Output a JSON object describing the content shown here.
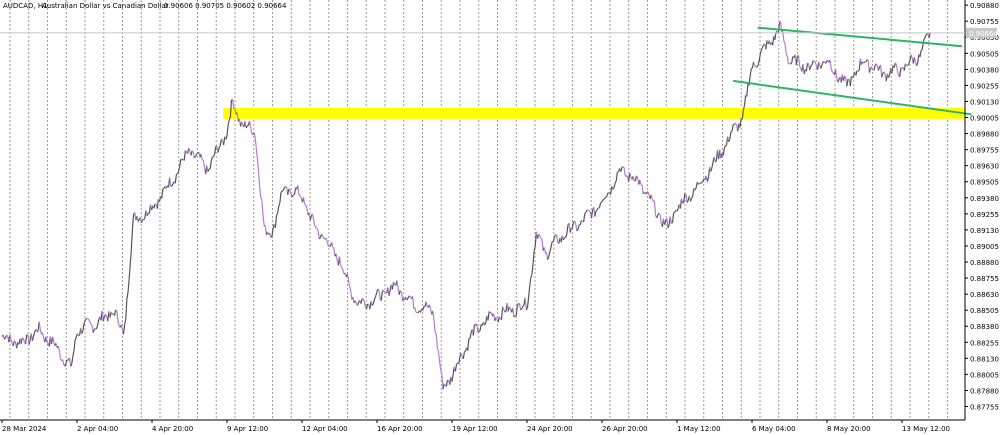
{
  "header": {
    "symbol_tf": "AUDCAD, H1:",
    "description": "Australian Dollar vs Canadian Dollar",
    "ohlc": "0.90606 0.90705 0.90602 0.90664"
  },
  "price_tag": "0.90664",
  "chart_data": {
    "type": "line",
    "symbol": "AUDCAD",
    "timeframe": "H1",
    "ylim": [
      0.8765,
      0.9092
    ],
    "y_ticks": [
      "0.90880",
      "0.90755",
      "0.90630",
      "0.90505",
      "0.90380",
      "0.90255",
      "0.90130",
      "0.90005",
      "0.89880",
      "0.89755",
      "0.89630",
      "0.89505",
      "0.89380",
      "0.89255",
      "0.89130",
      "0.89005",
      "0.88880",
      "0.88755",
      "0.88630",
      "0.88505",
      "0.88380",
      "0.88255",
      "0.88130",
      "0.88005",
      "0.87880",
      "0.87755"
    ],
    "x_ticks": [
      "28 Mar 2024",
      "2 Apr 04:00",
      "4 Apr 20:00",
      "9 Apr 12:00",
      "12 Apr 04:00",
      "16 Apr 20:00",
      "19 Apr 12:00",
      "24 Apr 20:00",
      "26 Apr 20:00",
      "1 May 12:00",
      "6 May 04:00",
      "8 May 20:00",
      "13 May 12:00"
    ],
    "x_tick_index": [
      0,
      4,
      8,
      12,
      16,
      20,
      24,
      28,
      32,
      36,
      40,
      44,
      48
    ],
    "n_periods": 52,
    "grid_vertical": true,
    "price_path": [
      [
        0,
        0.883
      ],
      [
        1,
        0.8825
      ],
      [
        2,
        0.8835
      ],
      [
        3,
        0.882
      ],
      [
        3.7,
        0.8805
      ],
      [
        4,
        0.8835
      ],
      [
        5,
        0.884
      ],
      [
        6,
        0.885
      ],
      [
        6.5,
        0.883
      ],
      [
        7,
        0.892
      ],
      [
        8,
        0.893
      ],
      [
        9,
        0.895
      ],
      [
        10,
        0.8975
      ],
      [
        11,
        0.896
      ],
      [
        12,
        0.899
      ],
      [
        12.3,
        0.9012
      ],
      [
        12.8,
        0.8995
      ],
      [
        13.5,
        0.899
      ],
      [
        14,
        0.891
      ],
      [
        14.5,
        0.8915
      ],
      [
        15,
        0.8945
      ],
      [
        16,
        0.894
      ],
      [
        16.5,
        0.892
      ],
      [
        17,
        0.891
      ],
      [
        18,
        0.889
      ],
      [
        18.5,
        0.887
      ],
      [
        19,
        0.8855
      ],
      [
        20,
        0.886
      ],
      [
        21,
        0.887
      ],
      [
        22,
        0.8855
      ],
      [
        23,
        0.885
      ],
      [
        23.5,
        0.879
      ],
      [
        24,
        0.88
      ],
      [
        25,
        0.883
      ],
      [
        26,
        0.8845
      ],
      [
        27,
        0.885
      ],
      [
        28,
        0.8855
      ],
      [
        28.5,
        0.891
      ],
      [
        29,
        0.8895
      ],
      [
        30,
        0.891
      ],
      [
        31,
        0.892
      ],
      [
        32,
        0.8935
      ],
      [
        33,
        0.896
      ],
      [
        34,
        0.895
      ],
      [
        35,
        0.8925
      ],
      [
        35.5,
        0.8915
      ],
      [
        36,
        0.893
      ],
      [
        37,
        0.8945
      ],
      [
        38,
        0.8965
      ],
      [
        39,
        0.899
      ],
      [
        39.5,
        0.9
      ],
      [
        40,
        0.904
      ],
      [
        41,
        0.906
      ],
      [
        41.5,
        0.907
      ],
      [
        42,
        0.9045
      ],
      [
        43,
        0.904
      ],
      [
        44,
        0.9045
      ],
      [
        45,
        0.9025
      ],
      [
        46,
        0.9045
      ],
      [
        47,
        0.9035
      ],
      [
        48,
        0.9038
      ],
      [
        49,
        0.905
      ],
      [
        49.5,
        0.9066
      ]
    ],
    "annotations": [
      {
        "type": "horizontal_zone",
        "y_top": 0.9008,
        "y_bottom": 0.89995,
        "x_start": 11.8,
        "color": "#ffff00"
      },
      {
        "type": "trendline",
        "p1": [
          40.3,
          0.90705
        ],
        "p2": [
          51.2,
          0.9056
        ],
        "color": "#2db36a"
      },
      {
        "type": "trendline",
        "p1": [
          39.0,
          0.9029
        ],
        "p2": [
          51.7,
          0.9003
        ],
        "color": "#2db36a"
      }
    ],
    "current_price": 0.90664
  },
  "colors": {
    "background": "#ffffff",
    "grid": "#9a9a9a",
    "price_up": "#555555",
    "price_down": "#b57ad6",
    "zone": "#ffff00",
    "trendline": "#2db36a",
    "price_tag": "#c8c8c8"
  }
}
